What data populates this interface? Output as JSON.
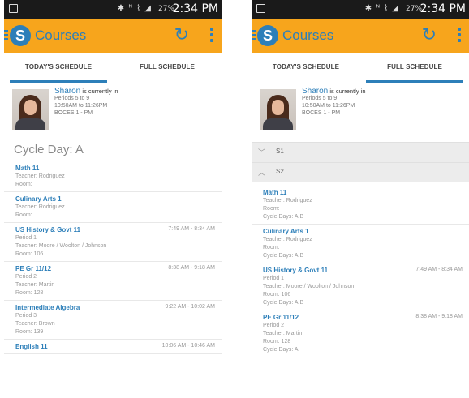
{
  "status_bar": {
    "time": "2:34 PM",
    "battery": "27%",
    "icons": "✱ ᴺ ⌇ ◢"
  },
  "app": {
    "title": "Courses",
    "logo_letter": "S"
  },
  "tabs": {
    "today": "TODAY'S SCHEDULE",
    "full": "FULL SCHEDULE"
  },
  "profile": {
    "name": "Sharon",
    "status": "is currently in",
    "periods": "Periods 5 to 9",
    "time_range": "10:50AM to 11:26PM",
    "location": "BOCES 1 - PM"
  },
  "left_screen": {
    "active_tab": "today",
    "cycle_day": "Cycle Day: A",
    "courses": [
      {
        "name": "Math 11",
        "time": "",
        "lines": [
          "Teacher: Rodriguez",
          "Room:"
        ]
      },
      {
        "name": "Culinary Arts 1",
        "time": "",
        "lines": [
          "Teacher: Rodriguez",
          "Room:"
        ]
      },
      {
        "name": "US History & Govt 11",
        "time": "7:49 AM - 8:34 AM",
        "lines": [
          "Period 1",
          "Teacher: Moore / Woolton / Johnson",
          "Room: 106"
        ]
      },
      {
        "name": "PE Gr 11/12",
        "time": "8:38 AM - 9:18 AM",
        "lines": [
          "Period 2",
          "Teacher: Martin",
          "Room: 128"
        ]
      },
      {
        "name": "Intermediate Algebra",
        "time": "9:22 AM - 10:02 AM",
        "lines": [
          "Period 3",
          "Teacher: Brown",
          "Room: 139"
        ]
      },
      {
        "name": "English 11",
        "time": "10:06 AM - 10:46 AM",
        "lines": []
      }
    ]
  },
  "right_screen": {
    "active_tab": "full",
    "sections": [
      {
        "label": "S1",
        "chevron": "﹀",
        "expanded": false
      },
      {
        "label": "S2",
        "chevron": "︿",
        "expanded": true
      }
    ],
    "courses": [
      {
        "name": "Math 11",
        "time": "",
        "lines": [
          "Teacher: Rodriguez",
          "Room:",
          "Cycle Days: A,B"
        ]
      },
      {
        "name": "Culinary Arts 1",
        "time": "",
        "lines": [
          "Teacher: Rodriguez",
          "Room:",
          "Cycle Days: A,B"
        ]
      },
      {
        "name": "US History & Govt 11",
        "time": "7:49 AM - 8:34 AM",
        "lines": [
          "Period 1",
          "Teacher: Moore / Woolton / Johnson",
          "Room: 106",
          "Cycle Days: A,B"
        ]
      },
      {
        "name": "PE Gr 11/12",
        "time": "8:38 AM - 9:18 AM",
        "lines": [
          "Period 2",
          "Teacher: Martin",
          "Room: 128",
          "Cycle Days: A"
        ]
      }
    ]
  },
  "colors": {
    "accent": "#f7a51c",
    "brand_blue": "#2d7fb9"
  }
}
